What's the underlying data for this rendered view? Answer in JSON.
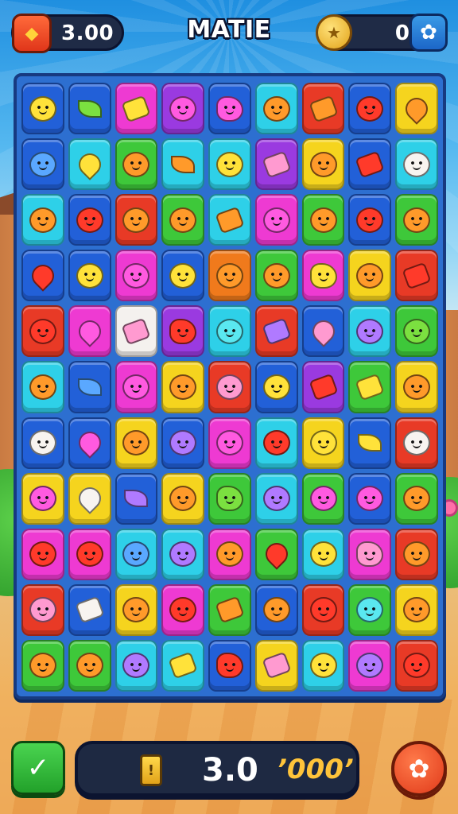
{
  "header": {
    "coins": "3.00",
    "title": "MATIE",
    "score": "0",
    "coin_icon": "tag-icon",
    "trophy_icon": "coin-icon",
    "settings_icon": "gear-icon"
  },
  "footer": {
    "value": "3.0",
    "bonus": "’000’",
    "hint_icon": "hammer-icon",
    "battery_icon": "battery-icon",
    "menu_icon": "gear-icon"
  },
  "board": {
    "columns": 9,
    "rows": 11,
    "colors": {
      "blue": "#2260d8",
      "cyan": "#2ed0e8",
      "magenta": "#ee3ad2",
      "purple": "#9a3ae0",
      "red": "#e83a26",
      "orange": "#f07a1c",
      "yellow": "#f5d41e",
      "green": "#3ec83a",
      "white": "#f4f1ee"
    },
    "tiles": [
      [
        "blue",
        "blue",
        "magenta",
        "purple",
        "blue",
        "cyan",
        "red",
        "blue",
        "yellow"
      ],
      [
        "blue",
        "cyan",
        "green",
        "cyan",
        "cyan",
        "purple",
        "yellow",
        "blue",
        "cyan"
      ],
      [
        "cyan",
        "blue",
        "red",
        "green",
        "cyan",
        "magenta",
        "green",
        "blue",
        "green"
      ],
      [
        "blue",
        "blue",
        "magenta",
        "blue",
        "orange",
        "green",
        "magenta",
        "yellow",
        "red"
      ],
      [
        "red",
        "magenta",
        "white",
        "purple",
        "cyan",
        "red",
        "blue",
        "cyan",
        "green"
      ],
      [
        "cyan",
        "blue",
        "magenta",
        "yellow",
        "red",
        "blue",
        "purple",
        "green",
        "yellow"
      ],
      [
        "blue",
        "blue",
        "yellow",
        "blue",
        "magenta",
        "cyan",
        "yellow",
        "blue",
        "red"
      ],
      [
        "yellow",
        "yellow",
        "blue",
        "yellow",
        "green",
        "cyan",
        "green",
        "blue",
        "green"
      ],
      [
        "magenta",
        "magenta",
        "cyan",
        "cyan",
        "magenta",
        "green",
        "cyan",
        "magenta",
        "red"
      ],
      [
        "red",
        "blue",
        "yellow",
        "magenta",
        "green",
        "blue",
        "red",
        "green",
        "yellow"
      ],
      [
        "green",
        "green",
        "cyan",
        "cyan",
        "blue",
        "yellow",
        "cyan",
        "magenta",
        "red"
      ]
    ],
    "candies": [
      [
        "yellow",
        "green",
        "yellow",
        "magenta",
        "magenta",
        "orange",
        "orange",
        "red",
        "orange"
      ],
      [
        "blue",
        "yellow",
        "orange",
        "orange",
        "yellow",
        "pink",
        "orange",
        "red",
        "white"
      ],
      [
        "orange",
        "red",
        "orange",
        "orange",
        "orange",
        "magenta",
        "orange",
        "red",
        "orange"
      ],
      [
        "red",
        "yellow",
        "magenta",
        "yellow",
        "orange",
        "orange",
        "yellow",
        "orange",
        "red"
      ],
      [
        "red",
        "magenta",
        "pink",
        "red",
        "cyan",
        "purple",
        "pink",
        "purple",
        "green"
      ],
      [
        "orange",
        "blue",
        "magenta",
        "orange",
        "pink",
        "yellow",
        "red",
        "yellow",
        "orange"
      ],
      [
        "white",
        "magenta",
        "orange",
        "purple",
        "magenta",
        "red",
        "yellow",
        "yellow",
        "white"
      ],
      [
        "magenta",
        "white",
        "purple",
        "orange",
        "green",
        "purple",
        "magenta",
        "magenta",
        "orange"
      ],
      [
        "red",
        "red",
        "blue",
        "purple",
        "orange",
        "red",
        "yellow",
        "pink",
        "orange"
      ],
      [
        "pink",
        "white",
        "orange",
        "red",
        "orange",
        "orange",
        "red",
        "cyan",
        "orange"
      ],
      [
        "orange",
        "orange",
        "purple",
        "yellow",
        "red",
        "pink",
        "yellow",
        "purple",
        "red"
      ]
    ],
    "shapes": [
      [
        "round",
        "leaf",
        "square",
        "round",
        "blob",
        "round",
        "square",
        "round",
        "drop"
      ],
      [
        "round",
        "drop",
        "round",
        "leaf",
        "round",
        "square",
        "round",
        "square",
        "round"
      ],
      [
        "round",
        "round",
        "round",
        "round",
        "square",
        "round",
        "round",
        "round",
        "round"
      ],
      [
        "drop",
        "round",
        "round",
        "round",
        "round",
        "round",
        "blob",
        "round",
        "square"
      ],
      [
        "round",
        "drop",
        "square",
        "blob",
        "round",
        "square",
        "drop",
        "round",
        "round"
      ],
      [
        "round",
        "leaf",
        "round",
        "round",
        "round",
        "round",
        "square",
        "square",
        "round"
      ],
      [
        "round",
        "drop",
        "round",
        "round",
        "round",
        "round",
        "round",
        "leaf",
        "round"
      ],
      [
        "round",
        "drop",
        "leaf",
        "round",
        "blob",
        "round",
        "round",
        "round",
        "round"
      ],
      [
        "round",
        "round",
        "round",
        "round",
        "round",
        "drop",
        "round",
        "blob",
        "round"
      ],
      [
        "round",
        "square",
        "round",
        "round",
        "square",
        "round",
        "round",
        "round",
        "round"
      ],
      [
        "round",
        "round",
        "round",
        "square",
        "blob",
        "square",
        "round",
        "round",
        "round"
      ]
    ],
    "candy_colors": {
      "yellow": "#ffe23a",
      "green": "#7be040",
      "orange": "#ff9a2a",
      "red": "#ff3a2a",
      "magenta": "#ff5ae0",
      "pink": "#ff9ad0",
      "blue": "#5aa8ff",
      "cyan": "#5ae8f0",
      "purple": "#b07aff",
      "white": "#f8f4f0"
    }
  }
}
